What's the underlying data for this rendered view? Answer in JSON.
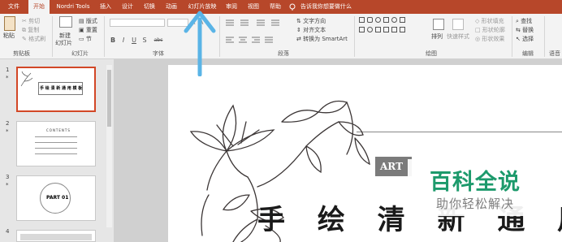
{
  "menu": {
    "items": [
      "文件",
      "开始",
      "Nordri Tools",
      "插入",
      "设计",
      "切换",
      "动画",
      "幻灯片放映",
      "审阅",
      "视图",
      "帮助"
    ],
    "active_index": 1,
    "tell_me": "告诉我你想要做什么"
  },
  "ribbon": {
    "clipboard": {
      "paste": "粘贴",
      "cut": "剪切",
      "copy": "复制",
      "format_painter": "格式刷",
      "group": "剪贴板"
    },
    "slides": {
      "new_slide": "新建",
      "new_slide_2": "幻灯片",
      "layout": "版式",
      "reset": "重置",
      "section": "节",
      "group": "幻灯片"
    },
    "font": {
      "bold": "B",
      "italic": "I",
      "underline": "U",
      "shadow": "S",
      "strike": "abc",
      "group": "字体"
    },
    "paragraph": {
      "text_direction": "文字方向",
      "align_text": "对齐文本",
      "smartart": "转换为 SmartArt",
      "group": "段落"
    },
    "drawing": {
      "arrange": "排列",
      "quick_styles": "快速样式",
      "fill": "形状填充",
      "outline": "形状轮廓",
      "effects": "形状效果",
      "group": "绘图"
    },
    "editing": {
      "find": "查找",
      "replace": "替换",
      "select": "选择",
      "group": "编辑"
    },
    "voice_group": "语音"
  },
  "slides": [
    {
      "number": "1",
      "title": "手 绘 清 新 通 用 模 板"
    },
    {
      "number": "2",
      "title": "CONTENTS"
    },
    {
      "number": "3",
      "title": "PART 01"
    },
    {
      "number": "4",
      "title": ""
    }
  ],
  "canvas": {
    "title": "手 绘 清 新 通 用 模 板",
    "badge": "ART"
  },
  "watermark": {
    "title": "百科全说",
    "subtitle": "助你轻松解决"
  },
  "colors": {
    "accent": "#b7472a",
    "selected_thumb": "#d24726",
    "arrow": "#5ab4e6",
    "watermark": "#1d9a6c"
  }
}
